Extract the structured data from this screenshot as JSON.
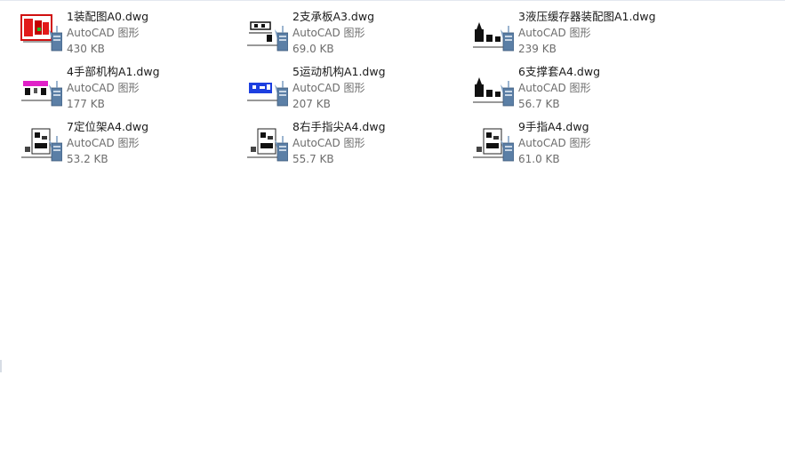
{
  "files": [
    {
      "name": "1装配图A0.dwg",
      "type": "AutoCAD 图形",
      "size": "430 KB",
      "thumb": "red-assembly"
    },
    {
      "name": "2支承板A3.dwg",
      "type": "AutoCAD 图形",
      "size": "69.0 KB",
      "thumb": "line-drawing"
    },
    {
      "name": "3液压缓存器装配图A1.dwg",
      "type": "AutoCAD 图形",
      "size": "239 KB",
      "thumb": "black-parts"
    },
    {
      "name": "4手部机构A1.dwg",
      "type": "AutoCAD 图形",
      "size": "177 KB",
      "thumb": "magenta-drawing"
    },
    {
      "name": "5运动机构A1.dwg",
      "type": "AutoCAD 图形",
      "size": "207 KB",
      "thumb": "blue-drawing"
    },
    {
      "name": "6支撑套A4.dwg",
      "type": "AutoCAD 图形",
      "size": "56.7 KB",
      "thumb": "black-parts"
    },
    {
      "name": "7定位架A4.dwg",
      "type": "AutoCAD 图形",
      "size": "53.2 KB",
      "thumb": "a4-sheet"
    },
    {
      "name": "8右手指尖A4.dwg",
      "type": "AutoCAD 图形",
      "size": "55.7 KB",
      "thumb": "a4-sheet"
    },
    {
      "name": "9手指A4.dwg",
      "type": "AutoCAD 图形",
      "size": "61.0 KB",
      "thumb": "a4-sheet"
    }
  ],
  "colors": {
    "name_text": "#1a1a1a",
    "meta_text": "#6d6d6d",
    "autocad_badge": "#5b7fa6"
  }
}
